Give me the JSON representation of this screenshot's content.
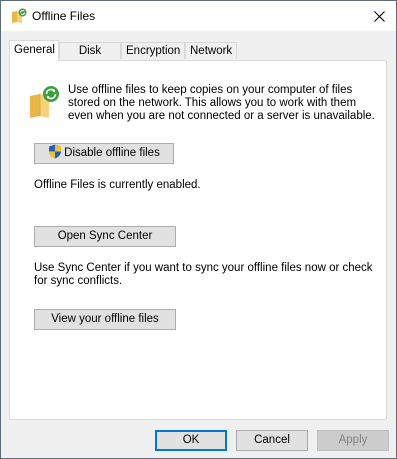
{
  "window": {
    "title": "Offline Files",
    "title_icon": "offline-files-icon"
  },
  "tabs": [
    {
      "label": "General",
      "active": true
    },
    {
      "label": "Disk Usage",
      "active": false
    },
    {
      "label": "Encryption",
      "active": false
    },
    {
      "label": "Network",
      "active": false
    }
  ],
  "general": {
    "info_text": "Use offline files to keep copies on your computer of files stored on the network.  This allows you to work with them even when you are not connected or a server is unavailable.",
    "disable_button": "Disable offline files",
    "status_text": "Offline Files is currently enabled.",
    "sync_center_button": "Open Sync Center",
    "sync_text": "Use Sync Center if you want to sync your offline files now or check for sync conflicts.",
    "view_button": "View your offline files"
  },
  "footer": {
    "ok": "OK",
    "cancel": "Cancel",
    "apply": "Apply"
  },
  "colors": {
    "accent": "#0078d7",
    "sync_green": "#3aa13a",
    "folder_yellow": "#f4c85a"
  }
}
